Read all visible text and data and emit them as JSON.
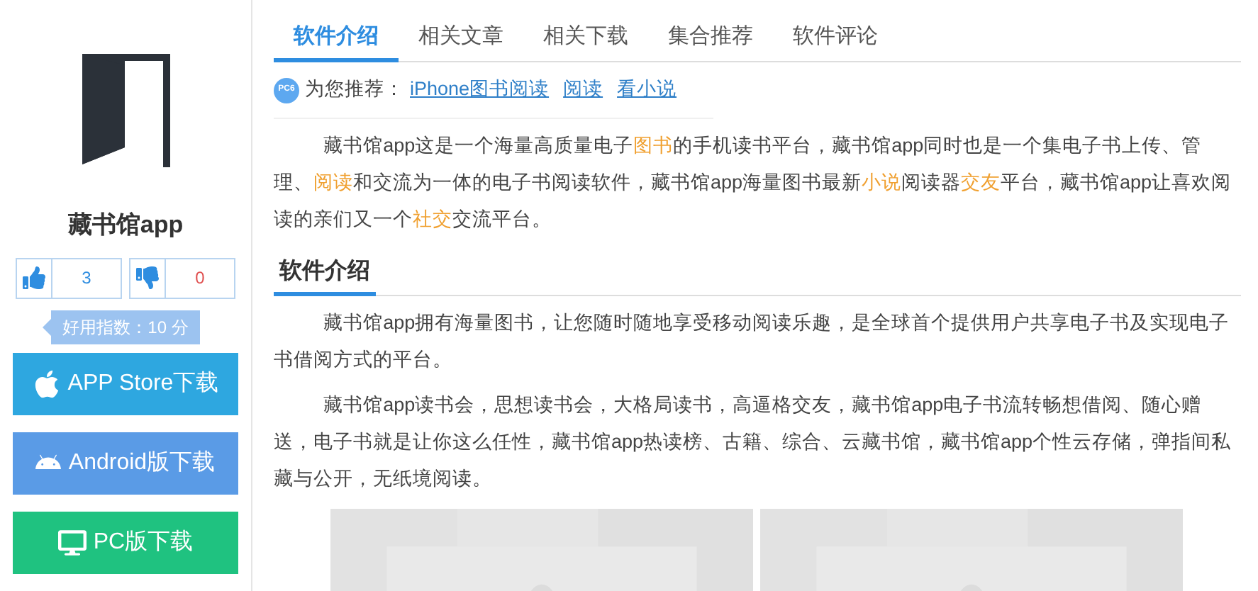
{
  "app": {
    "name": "藏书馆app"
  },
  "votes": [
    {
      "kind": "up",
      "count": "3"
    },
    {
      "kind": "down",
      "count": "0"
    }
  ],
  "score": "好用指数：10 分",
  "downloads": [
    {
      "kind": "apple",
      "label": "APP Store下载"
    },
    {
      "kind": "android",
      "label": "Android版下载"
    },
    {
      "kind": "pc",
      "label": "PC版下载"
    }
  ],
  "tabs": [
    {
      "label": "软件介绍",
      "selected": true
    },
    {
      "label": "相关文章",
      "selected": false
    },
    {
      "label": "相关下载",
      "selected": false
    },
    {
      "label": "集合推荐",
      "selected": false
    },
    {
      "label": "软件评论",
      "selected": false
    }
  ],
  "recommend": {
    "badge": "PC6",
    "label": "为您推荐：",
    "links": [
      "iPhone图书阅读",
      "阅读",
      "看小说"
    ]
  },
  "intro": [
    [
      {
        "text": "藏书馆app这是一个海量高质量电子",
        "link": false
      },
      {
        "text": "图书",
        "link": true
      },
      {
        "text": "的手机读书平台，藏书馆app同时也是一个集电子书上传、管理、",
        "link": false
      },
      {
        "text": "阅读",
        "link": true
      },
      {
        "text": "和交流为一体的电子书阅读软件，藏书馆app海量图书最新",
        "link": false
      },
      {
        "text": "小说",
        "link": true
      },
      {
        "text": "阅读器",
        "link": false
      },
      {
        "text": "交友",
        "link": true
      },
      {
        "text": "平台，藏书馆app让喜欢阅读的亲们又一个",
        "link": false
      },
      {
        "text": "社交",
        "link": true
      },
      {
        "text": "交流平台。",
        "link": false
      }
    ]
  ],
  "section": {
    "title": "软件介绍",
    "paragraphs": [
      "藏书馆app拥有海量图书，让您随时随地享受移动阅读乐趣，是全球首个提供用户共享电子书及实现电子书借阅方式的平台。",
      "藏书馆app读书会，思想读书会，大格局读书，高逼格交友，藏书馆app电子书流转畅想借阅、随心赠送，电子书就是让你这么任性，藏书馆app热读榜、古籍、综合、云藏书馆，藏书馆app个性云存储，弹指间私藏与公开，无纸境阅读。"
    ]
  }
}
